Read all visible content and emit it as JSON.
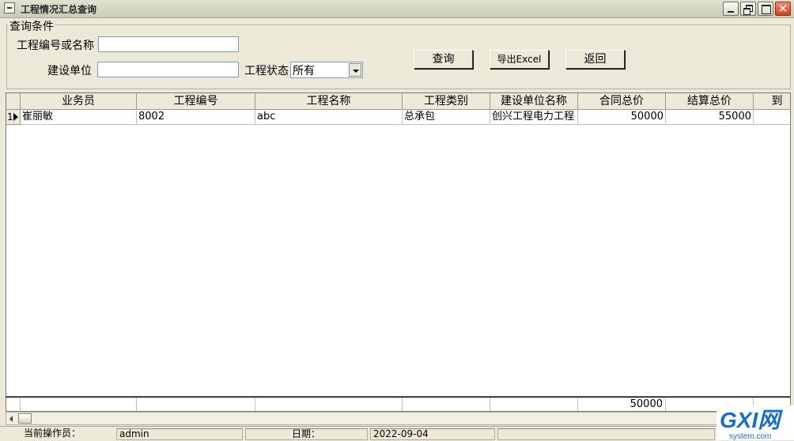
{
  "window": {
    "title": "工程情况汇总查询",
    "close_glyph": "✕"
  },
  "query_group": {
    "title": "查询条件"
  },
  "form": {
    "project_label": "工程编号或名称",
    "project_value": "",
    "unit_label": "建设单位",
    "unit_value": "",
    "status_label": "工程状态",
    "status_value": "所有"
  },
  "buttons": {
    "query": "查询",
    "export": "导出Excel",
    "back": "返回"
  },
  "grid": {
    "columns": [
      "业务员",
      "工程编号",
      "工程名称",
      "工程类别",
      "建设单位名称",
      "合同总价",
      "结算总价",
      "到"
    ],
    "rows": [
      {
        "index": "1",
        "cells": [
          "崔丽敏",
          "8002",
          "abc",
          "总承包",
          "创兴工程电力工程",
          "50000",
          "55000",
          ""
        ]
      }
    ],
    "totals": {
      "contract_total": "50000"
    }
  },
  "status_bar": {
    "operator_label": "当前操作员：",
    "operator_value": "admin",
    "date_label": "日期：",
    "date_value": "2022-09-04"
  },
  "watermark": {
    "brand": "GXI网",
    "domain": "system.com"
  },
  "colors": {
    "title_bar": "#d3d7c2",
    "face": "#ece9d8",
    "grid_bg": "#ffffff",
    "close_button": "#d2401c",
    "watermark_blue": "#1a6fc4"
  }
}
